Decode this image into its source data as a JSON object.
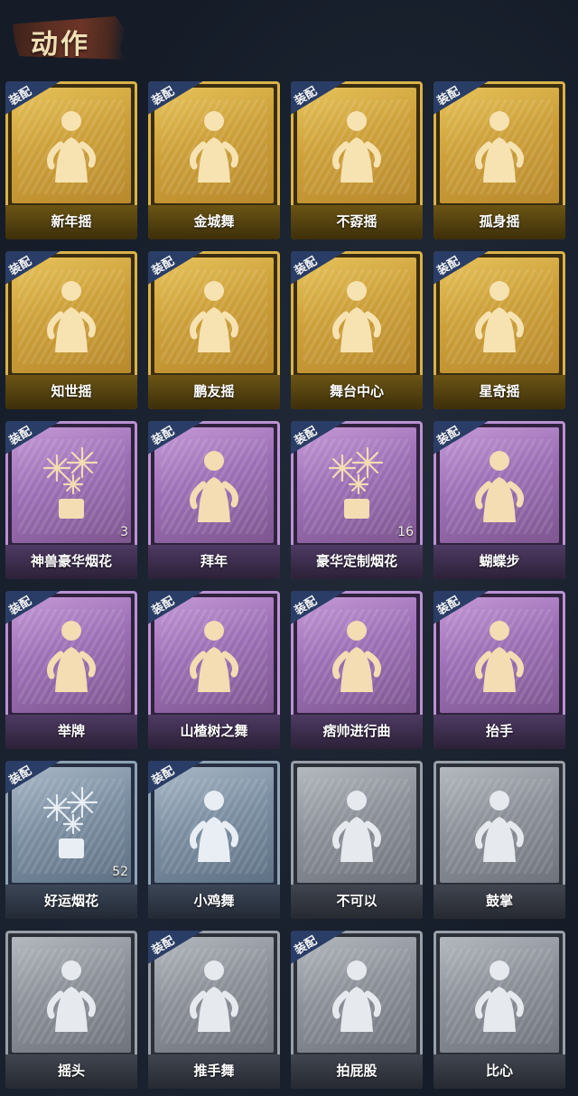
{
  "header": {
    "title": "动作"
  },
  "equip_label": "装配",
  "cards": [
    {
      "name": "新年摇",
      "tier": "gold",
      "equipped": true,
      "count": ""
    },
    {
      "name": "金城舞",
      "tier": "gold",
      "equipped": true,
      "count": ""
    },
    {
      "name": "不孬摇",
      "tier": "gold",
      "equipped": true,
      "count": ""
    },
    {
      "name": "孤身摇",
      "tier": "gold",
      "equipped": true,
      "count": ""
    },
    {
      "name": "知世摇",
      "tier": "gold",
      "equipped": true,
      "count": ""
    },
    {
      "name": "鹏友摇",
      "tier": "gold",
      "equipped": true,
      "count": ""
    },
    {
      "name": "舞台中心",
      "tier": "gold",
      "equipped": true,
      "count": ""
    },
    {
      "name": "星奇摇",
      "tier": "gold",
      "equipped": true,
      "count": ""
    },
    {
      "name": "神兽豪华烟花",
      "tier": "purple",
      "equipped": true,
      "count": "3"
    },
    {
      "name": "拜年",
      "tier": "purple",
      "equipped": true,
      "count": ""
    },
    {
      "name": "豪华定制烟花",
      "tier": "purple",
      "equipped": true,
      "count": "16"
    },
    {
      "name": "蝴蝶步",
      "tier": "purple",
      "equipped": true,
      "count": ""
    },
    {
      "name": "举牌",
      "tier": "purple",
      "equipped": true,
      "count": ""
    },
    {
      "name": "山楂树之舞",
      "tier": "purple",
      "equipped": true,
      "count": ""
    },
    {
      "name": "痞帅进行曲",
      "tier": "purple",
      "equipped": true,
      "count": ""
    },
    {
      "name": "抬手",
      "tier": "purple",
      "equipped": true,
      "count": ""
    },
    {
      "name": "好运烟花",
      "tier": "blue",
      "equipped": true,
      "count": "52"
    },
    {
      "name": "小鸡舞",
      "tier": "blue",
      "equipped": true,
      "count": ""
    },
    {
      "name": "不可以",
      "tier": "gray",
      "equipped": false,
      "count": ""
    },
    {
      "name": "鼓掌",
      "tier": "gray",
      "equipped": false,
      "count": ""
    },
    {
      "name": "摇头",
      "tier": "gray",
      "equipped": false,
      "count": ""
    },
    {
      "name": "推手舞",
      "tier": "gray",
      "equipped": true,
      "count": ""
    },
    {
      "name": "拍屁股",
      "tier": "gray",
      "equipped": true,
      "count": ""
    },
    {
      "name": "比心",
      "tier": "gray",
      "equipped": false,
      "count": ""
    }
  ],
  "tier_colors": {
    "gold": "#d9b34a",
    "purple": "#b993d2",
    "blue": "#8ea3b5",
    "gray": "#9aa0a8"
  },
  "icon_names": [
    "dancer-new-year-icon",
    "dancer-golden-city-icon",
    "dancer-arms-up-icon",
    "dancer-solo-icon",
    "dancer-zhishi-icon",
    "dancer-pengyou-icon",
    "dancer-stage-center-icon",
    "dancer-xingqi-icon",
    "fireworks-box-icon",
    "bow-greeting-icon",
    "fireworks-box-icon",
    "butterfly-step-icon",
    "sign-holding-icon",
    "hawthorn-dance-icon",
    "swagger-march-icon",
    "raise-hand-icon",
    "fireworks-can-icon",
    "chicken-dance-icon",
    "no-gesture-icon",
    "clap-icon",
    "head-shake-icon",
    "push-hand-dance-icon",
    "butt-pat-icon",
    "heart-hands-icon"
  ]
}
